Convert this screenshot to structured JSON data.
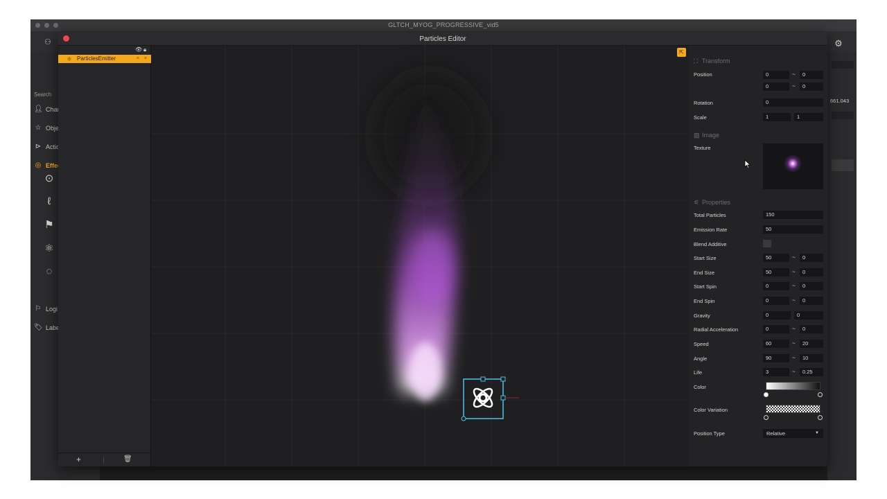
{
  "window": {
    "title": "GLTCH_MYOG_PROGRESSIVE_vid5"
  },
  "sidebar": {
    "search_label": "Search",
    "items": [
      {
        "label": "Char",
        "icon": "person-icon"
      },
      {
        "label": "Obje",
        "icon": "star-icon"
      },
      {
        "label": "Actio",
        "icon": "play-circle-icon"
      },
      {
        "label": "Effec",
        "icon": "effects-icon",
        "active": true
      },
      {
        "label": "Logi",
        "icon": "logic-icon"
      },
      {
        "label": "Labe",
        "icon": "tag-icon"
      }
    ],
    "tools": [
      "location-pin-icon",
      "brush-icon",
      "flag-icon",
      "atom-icon",
      "ring-icon"
    ]
  },
  "background": {
    "side_value": "661.043",
    "accent_color": "#f3a91b"
  },
  "modal": {
    "title": "Particles Editor",
    "hierarchy": {
      "emitter_label": "ParticlesEmitter",
      "add_label": "+",
      "delete_icon": "trash-icon"
    },
    "canvas": {
      "grid": true,
      "particle_color": "#c96de6"
    },
    "properties": {
      "transform": {
        "section": "Transform",
        "position_label": "Position",
        "position": {
          "x_min": "0",
          "x_max": "0",
          "y_min": "0",
          "y_max": "0"
        },
        "rotation_label": "Rotation",
        "rotation": "0",
        "scale_label": "Scale",
        "scale": {
          "x": "1",
          "y": "1"
        }
      },
      "image": {
        "section": "Image",
        "texture_label": "Texture"
      },
      "props": {
        "section": "Properties",
        "total_particles_label": "Total Particles",
        "total_particles": "150",
        "emission_rate_label": "Emission Rate",
        "emission_rate": "50",
        "blend_additive_label": "Blend Additive",
        "start_size_label": "Start Size",
        "start_size": {
          "min": "50",
          "max": "0"
        },
        "end_size_label": "End Size",
        "end_size": {
          "min": "50",
          "max": "0"
        },
        "start_spin_label": "Start Spin",
        "start_spin": {
          "min": "0",
          "max": "0"
        },
        "end_spin_label": "End Spin",
        "end_spin": {
          "min": "0",
          "max": "0"
        },
        "gravity_label": "Gravity",
        "gravity": {
          "x": "0",
          "y": "0"
        },
        "radial_label": "Radial Acceleration",
        "radial": {
          "min": "0",
          "max": "0"
        },
        "speed_label": "Speed",
        "speed": {
          "min": "60",
          "max": "20"
        },
        "angle_label": "Angle",
        "angle": {
          "min": "90",
          "max": "10"
        },
        "life_label": "Life",
        "life": {
          "min": "3",
          "max": "0.25"
        },
        "color_label": "Color",
        "color_variation_label": "Color Variation",
        "position_type_label": "Position Type",
        "position_type": "Relative"
      }
    }
  }
}
